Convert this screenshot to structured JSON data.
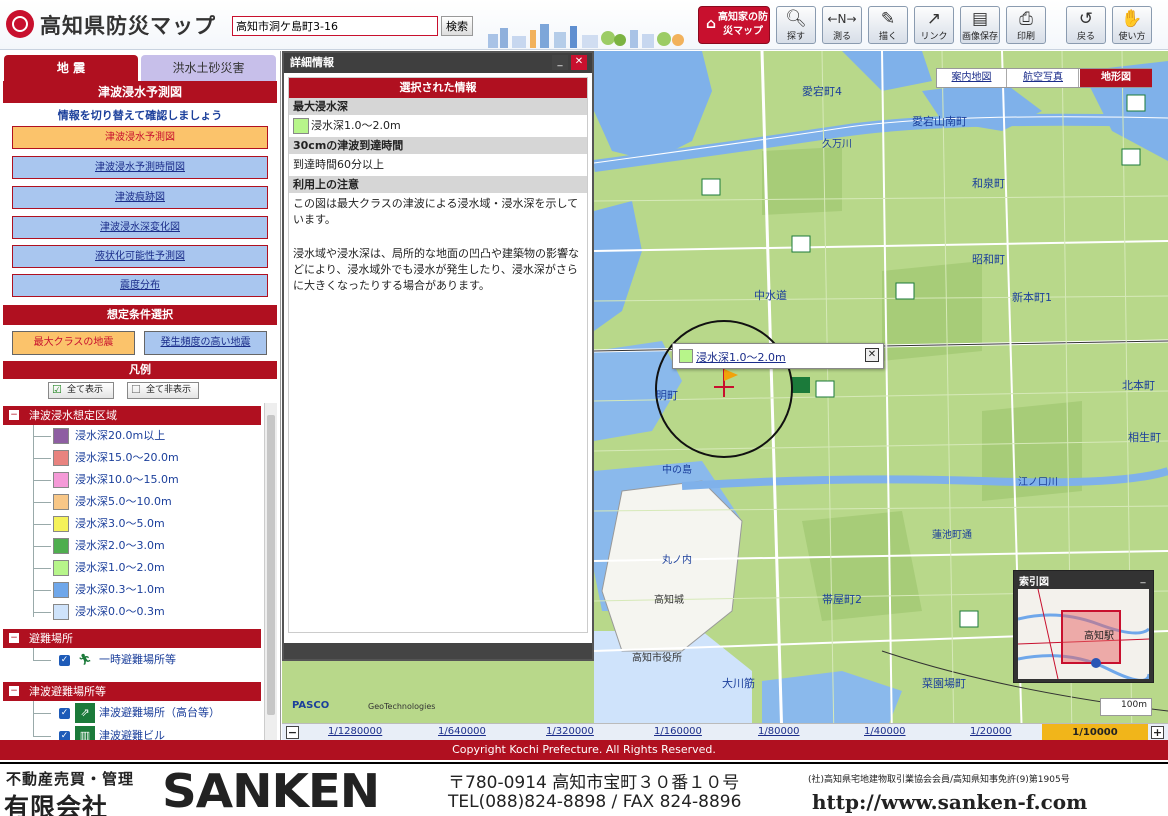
{
  "header": {
    "app_title": "高知県防災マップ",
    "search_value": "高知市洞ケ島町3-16",
    "search_button": "検索",
    "home_map_button": "高知家の防災マップ",
    "tools": [
      {
        "label": "探す",
        "icon": "magnifier"
      },
      {
        "label": "測る",
        "icon": "ruler"
      },
      {
        "label": "描く",
        "icon": "pen"
      },
      {
        "label": "リンク",
        "icon": "link"
      },
      {
        "label": "画像保存",
        "icon": "save"
      },
      {
        "label": "印刷",
        "icon": "printer"
      },
      {
        "label": "戻る",
        "icon": "back"
      },
      {
        "label": "使い方",
        "icon": "help"
      }
    ]
  },
  "left_panel": {
    "tabs": [
      "地 震",
      "洪水土砂災害"
    ],
    "heading": "津波浸水予測図",
    "subtitle": "情報を切り替えて確認しましょう",
    "map_buttons": [
      "津波浸水予測図",
      "津波浸水予測時間図",
      "津波痕跡図",
      "津波浸水深変化図",
      "液状化可能性予測図",
      "震度分布"
    ],
    "condition_heading": "想定条件選択",
    "conditions": [
      "最大クラスの地震",
      "発生頻度の高い地震"
    ],
    "legend_heading": "凡例",
    "show_all": "全て表示",
    "hide_all": "全て非表示",
    "legend_groups": {
      "tsunami_area": "津波浸水想定区域",
      "shelter": "避難場所",
      "tsunami_shelter": "津波避難場所等"
    },
    "legend_items": [
      {
        "label": "浸水深20.0m以上",
        "color": "#8e5ea2"
      },
      {
        "label": "浸水深15.0～20.0m",
        "color": "#e8837f"
      },
      {
        "label": "浸水深10.0～15.0m",
        "color": "#f59ad7"
      },
      {
        "label": "浸水深5.0～10.0m",
        "color": "#f8c787"
      },
      {
        "label": "浸水深3.0～5.0m",
        "color": "#f5f25a"
      },
      {
        "label": "浸水深2.0～3.0m",
        "color": "#4fae4f"
      },
      {
        "label": "浸水深1.0～2.0m",
        "color": "#b7f58a"
      },
      {
        "label": "浸水深0.3～1.0m",
        "color": "#6fa7ea"
      },
      {
        "label": "浸水深0.0～0.3m",
        "color": "#cfe3fb"
      }
    ],
    "shelter_items": [
      "一時避難場所等"
    ],
    "tsunami_shelter_items": [
      "津波避難場所（高台等）",
      "津波避難ビル"
    ]
  },
  "detail_panel": {
    "title": "詳細情報",
    "selected_heading": "選択された情報",
    "max_depth_heading": "最大浸水深",
    "max_depth_value": "浸水深1.0～2.0m",
    "arrival_heading": "30cmの津波到達時間",
    "arrival_value": "到達時間60分以上",
    "notes_heading": "利用上の注意",
    "note_1": "この図は最大クラスの津波による浸水域・浸水深を示しています。",
    "note_2": "浸水域や浸水深は、局所的な地面の凹凸や建築物の影響などにより、浸水域外でも浸水が発生したり、浸水深がさらに大きくなったりする場合があります。"
  },
  "map": {
    "map_types": [
      "案内地図",
      "航空写真",
      "地形図"
    ],
    "popup_label": "浸水深1.0～2.0m",
    "labels": [
      "愛宕町4",
      "愛宕山南町",
      "和泉町",
      "久万川",
      "昭和町",
      "新本町1",
      "中水道",
      "北本町",
      "相生町",
      "江ノ口川",
      "高知城",
      "高知市役所",
      "帯屋町2",
      "大川筋",
      "菜園場町",
      "明町",
      "丸ノ内",
      "中の島",
      "蓮池町通"
    ],
    "index_map_title": "索引図",
    "index_map_label": "高知駅",
    "scale_bar": "100m",
    "attribution_1": "PASCO",
    "attribution_2": "GeoTechnologies",
    "scales": [
      "1/1280000",
      "1/640000",
      "1/320000",
      "1/160000",
      "1/80000",
      "1/40000",
      "1/20000"
    ],
    "current_scale": "1/10000"
  },
  "copyright": "Copyright Kochi Prefecture. All Rights Reserved.",
  "footer": {
    "company_type": "不動産売買・管理",
    "company_corp": "有限会社",
    "company_name": "SANKEN",
    "address": "〒780-0914  高知市宝町３０番１０号",
    "phone": "TEL(088)824-8898 / FAX 824-8896",
    "license": "(社)高知県宅地建物取引業協会会員/高知県知事免許(9)第1905号",
    "url": "http://www.sanken-f.com"
  }
}
